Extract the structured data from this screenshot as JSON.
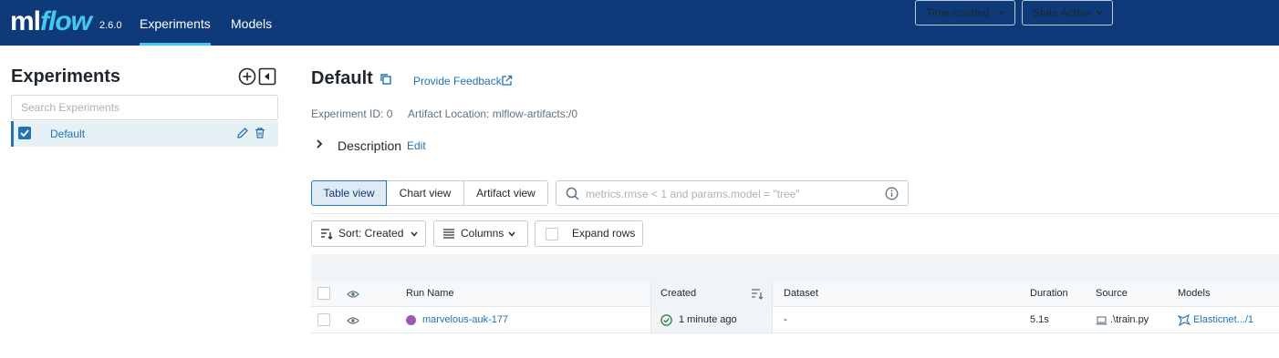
{
  "header": {
    "logo_ml": "ml",
    "logo_flow": "flow",
    "version": "2.6.0",
    "tabs": [
      {
        "label": "Experiments",
        "active": true
      },
      {
        "label": "Models",
        "active": false
      }
    ],
    "bg_color": "#0e3a79",
    "accent_color": "#43c9ed"
  },
  "sidebar": {
    "title": "Experiments",
    "search_placeholder": "Search Experiments",
    "experiments": [
      {
        "name": "Default",
        "checked": true
      }
    ]
  },
  "main": {
    "title": "Default",
    "feedback_label": "Provide Feedback",
    "experiment_id": "Experiment ID: 0",
    "artifact_location": "Artifact Location: mlflow-artifacts:/0",
    "description_label": "Description",
    "description_edit": "Edit"
  },
  "toolbar": {
    "views": [
      {
        "label": "Table view",
        "active": true
      },
      {
        "label": "Chart view",
        "active": false
      },
      {
        "label": "Artifact view",
        "active": false
      }
    ],
    "filter_placeholder": "metrics.rmse < 1 and params.model = \"tree\"",
    "time_dropdown": "Time created",
    "state_dropdown": "State Active",
    "sort_label": "Sort: Created",
    "columns_label": "Columns",
    "expand_label": "Expand rows"
  },
  "table": {
    "columns": [
      "Run Name",
      "Created",
      "Dataset",
      "Duration",
      "Source",
      "Models"
    ],
    "rows": [
      {
        "run_name": "marvelous-auk-177",
        "run_color": "#9b59b6",
        "created": "1 minute ago",
        "dataset": "-",
        "duration": "5.1s",
        "source": ".\\train.py",
        "models": "Elasticnet.../1"
      }
    ]
  }
}
